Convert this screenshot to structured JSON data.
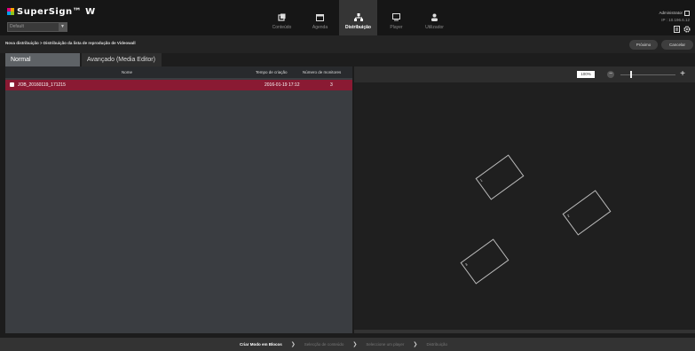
{
  "app": {
    "logo_text": "SuperSign™ W",
    "site_select": "Default"
  },
  "nav": [
    {
      "label": "Conteúdo",
      "icon": "content-icon"
    },
    {
      "label": "Agenda",
      "icon": "calendar-icon"
    },
    {
      "label": "Distribuição",
      "icon": "distribution-icon"
    },
    {
      "label": "Player",
      "icon": "monitor-icon"
    },
    {
      "label": "Utilizador",
      "icon": "user-icon"
    }
  ],
  "user": {
    "name": "Administrator",
    "ip": "IP : 10.196.6.12"
  },
  "breadcrumb": "Nova distribuição > Distribuição da lista de reprodução de Videowall",
  "buttons": {
    "next": "Próximo",
    "cancel": "Cancelar"
  },
  "tabs": {
    "normal": "Normal",
    "advanced": "Avançado (Media Editor)"
  },
  "table": {
    "columns": [
      "Nome",
      "Tempo de criação",
      "Número de monitores"
    ],
    "rows": [
      {
        "name": "JOB_20160119_171215",
        "created": "2016-01-19 17:12",
        "monitors": "3"
      }
    ]
  },
  "preview": {
    "zoom": "100%",
    "zoom_level": 0.2,
    "minus": "−",
    "plus": "+",
    "monitors": [
      {
        "label": "1"
      },
      {
        "label": "2"
      },
      {
        "label": "3"
      }
    ]
  },
  "wizard": {
    "steps": [
      "Criar Modo em Blocos",
      "Selecção de conteúdo",
      "Seleccione um player",
      "Distribuição"
    ],
    "active": 0
  },
  "colors": {
    "selected_row": "#8a1a33",
    "active_tab": "#5e6266"
  }
}
